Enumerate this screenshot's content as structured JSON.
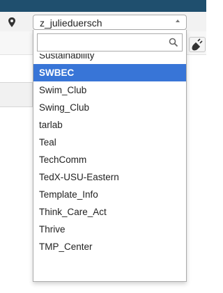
{
  "select": {
    "selected_value": "z_julieduersch"
  },
  "dropdown": {
    "search_value": "",
    "highlighted_index": 1,
    "options": [
      "Sustainability",
      "SWBEC",
      "Swim_Club",
      "Swing_Club",
      "tarlab",
      "Teal",
      "TechComm",
      "TedX-USU-Eastern",
      "Template_Info",
      "Think_Care_Act",
      "Thrive",
      "TMP_Center"
    ]
  },
  "colors": {
    "highlight": "#3875d7",
    "top_bar": "#1f4f6e"
  },
  "icons": {
    "location": "map-marker-icon",
    "search": "search-icon",
    "plug": "plug-icon",
    "arrow": "chevron-up-icon"
  }
}
